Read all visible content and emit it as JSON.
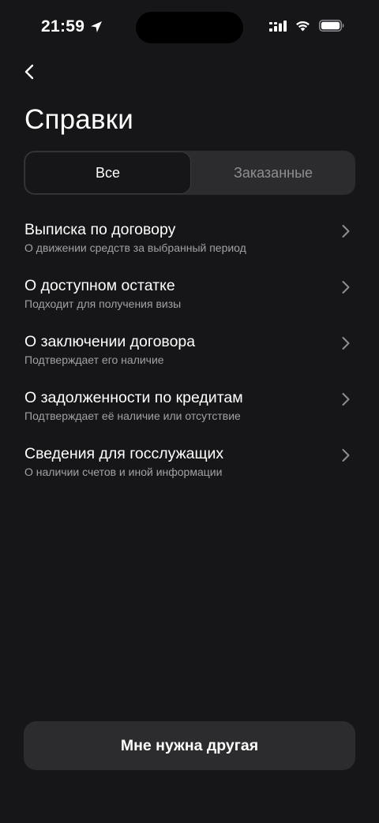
{
  "status_bar": {
    "time": "21:59",
    "icons": [
      "location-arrow-icon",
      "cellular-signal-icon",
      "wifi-icon",
      "battery-icon"
    ]
  },
  "header": {
    "back_icon": "chevron-left-icon",
    "title": "Справки"
  },
  "tabs": [
    {
      "label": "Все",
      "selected": true
    },
    {
      "label": "Заказанные",
      "selected": false
    }
  ],
  "certificates": [
    {
      "title": "Выписка по договору",
      "subtitle": "О движении средств за выбранный период"
    },
    {
      "title": "О доступном остатке",
      "subtitle": "Подходит для получения визы"
    },
    {
      "title": "О заключении договора",
      "subtitle": "Подтверждает его наличие"
    },
    {
      "title": "О задолженности по кредитам",
      "subtitle": "Подтверждает её наличие или отсутствие"
    },
    {
      "title": "Сведения для госслужащих",
      "subtitle": "О наличии счетов и иной информации"
    }
  ],
  "bottom_button": {
    "label": "Мне нужна другая"
  },
  "colors": {
    "background": "#161618",
    "surface": "#2c2c2e",
    "text_primary": "#ffffff",
    "text_secondary": "#a1a1a6",
    "text_inactive": "#8e8e93"
  }
}
